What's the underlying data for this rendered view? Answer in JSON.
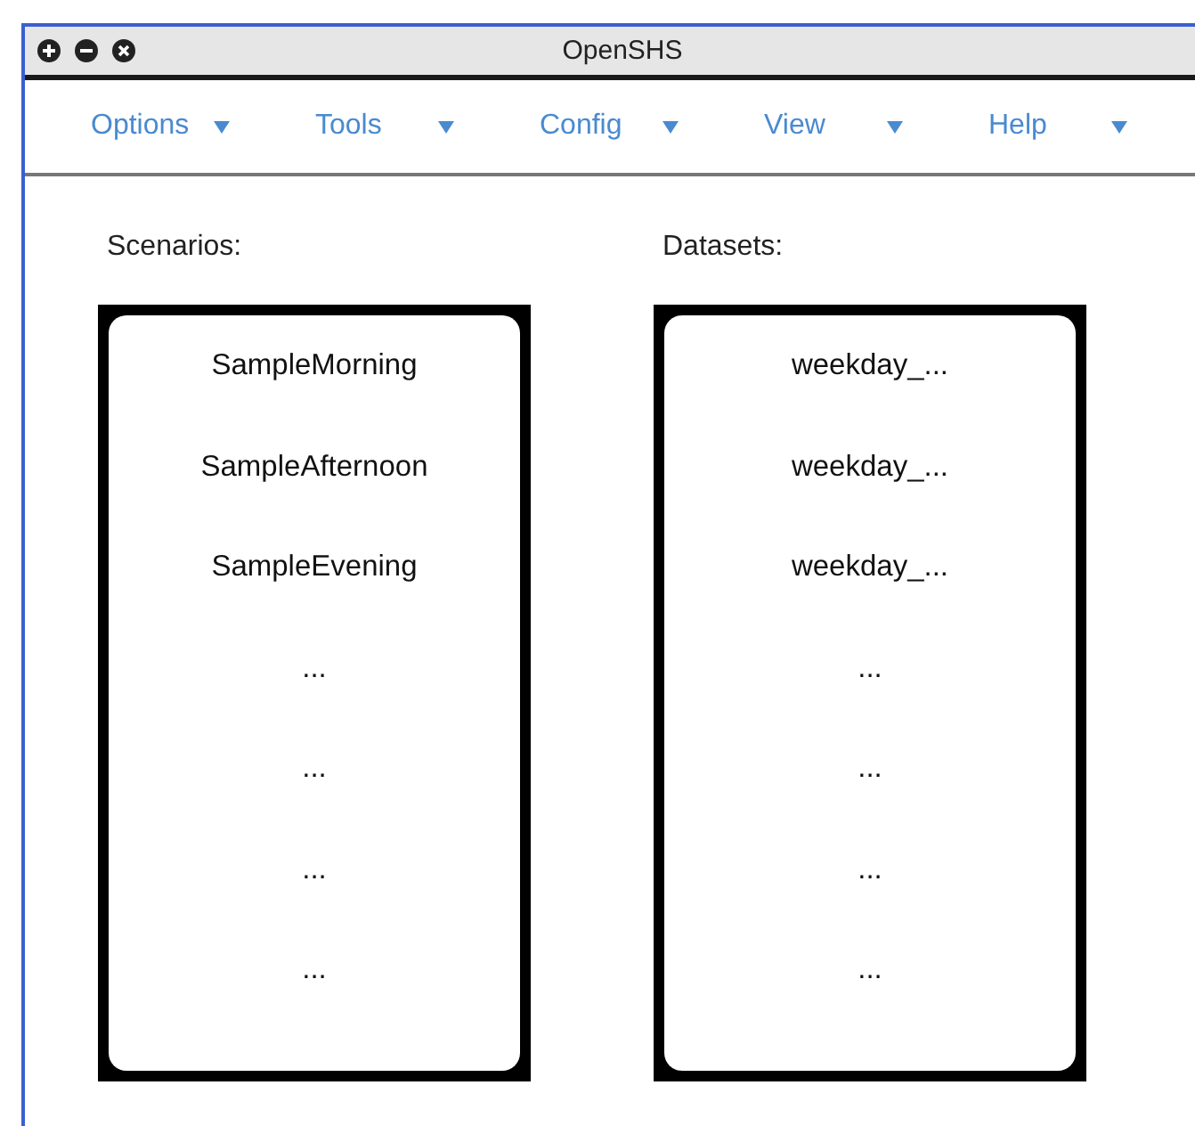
{
  "window": {
    "title": "OpenSHS"
  },
  "menu": [
    {
      "label": "Options"
    },
    {
      "label": "Tools"
    },
    {
      "label": "Config"
    },
    {
      "label": "View"
    },
    {
      "label": "Help"
    }
  ],
  "lists": [
    {
      "label": "Scenarios:",
      "items": [
        "SampleMorning",
        "SampleAfternoon",
        "SampleEvening",
        "...",
        "...",
        "...",
        "..."
      ]
    },
    {
      "label": "Datasets:",
      "items": [
        "weekday_...",
        "weekday_...",
        "weekday_...",
        "...",
        "...",
        "...",
        "..."
      ]
    }
  ]
}
